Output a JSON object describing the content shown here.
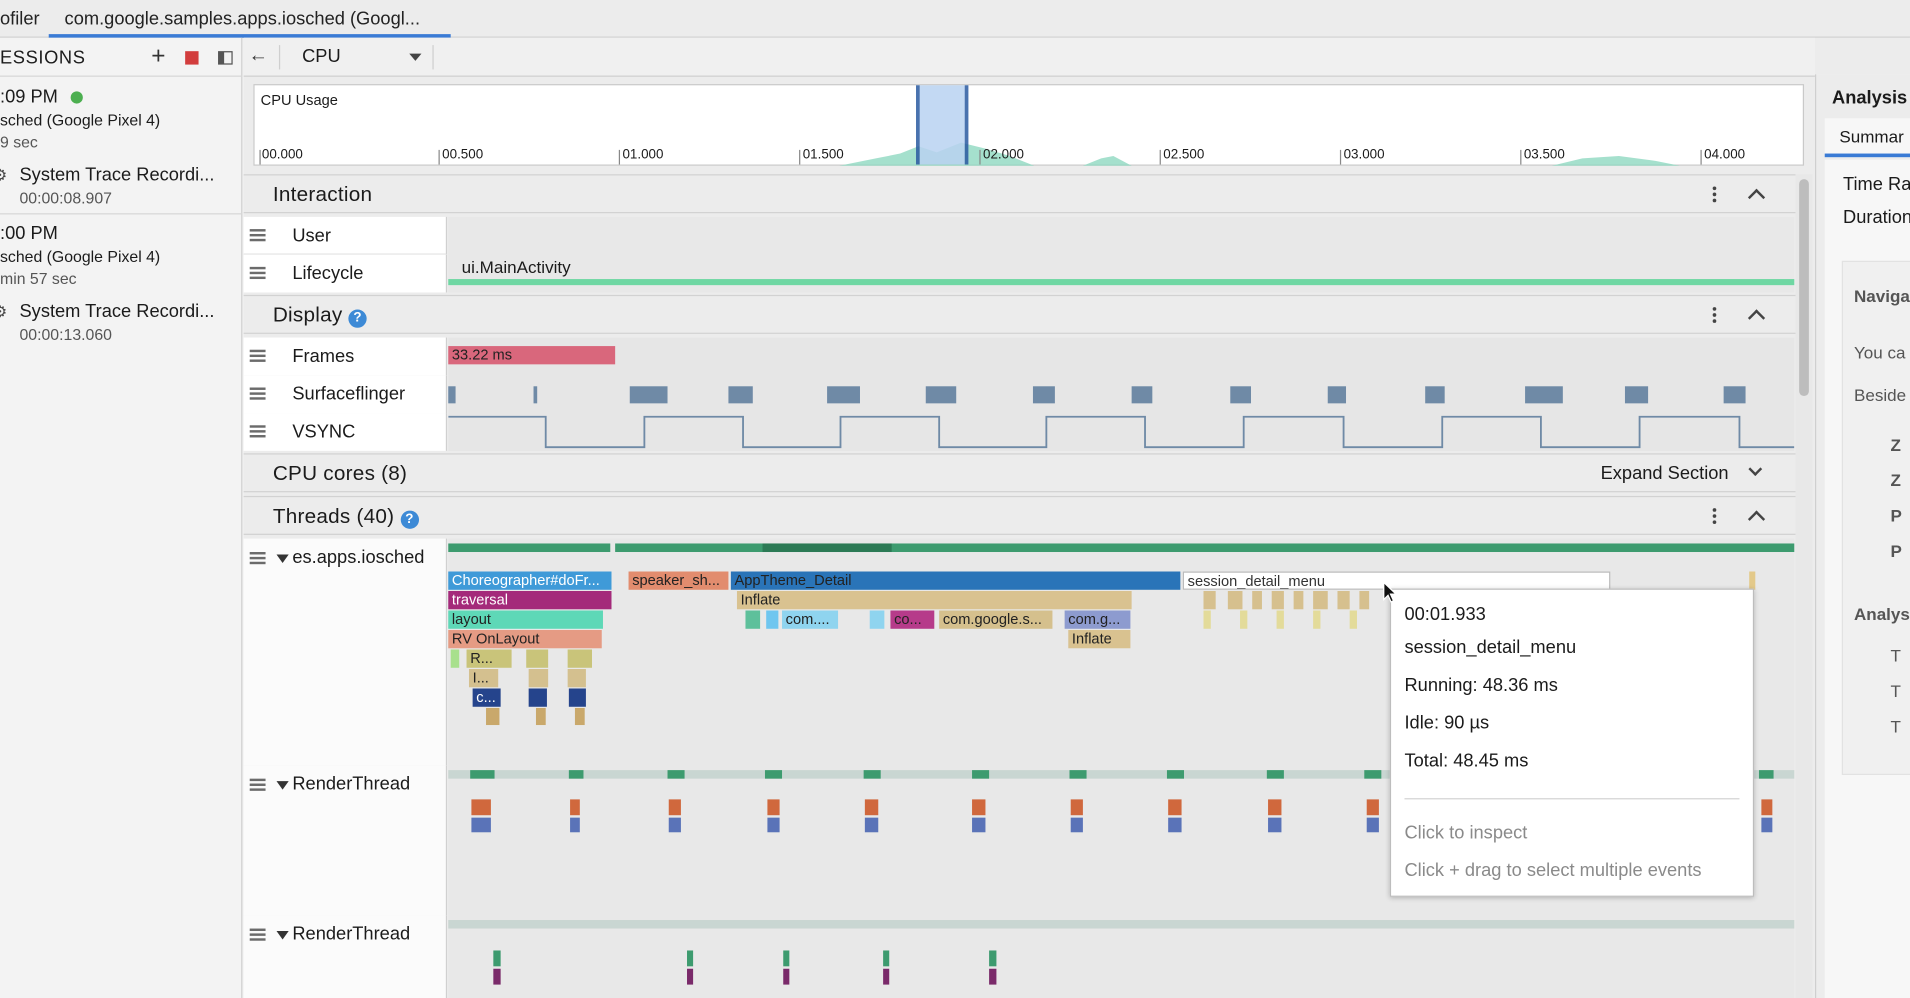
{
  "top_tabs": [
    "ofiler",
    "com.google.samples.apps.iosched (Googl..."
  ],
  "sidebar": {
    "title": "ESSIONS",
    "sessions": [
      {
        "time": ":09 PM",
        "device": "sched (Google Pixel 4)",
        "duration": "9 sec",
        "recording_title": "System Trace Recordi...",
        "recording_time": "00:00:08.907",
        "live": true
      },
      {
        "time": ":00 PM",
        "device": "sched (Google Pixel 4)",
        "duration": "min 57 sec",
        "recording_title": "System Trace Recordi...",
        "recording_time": "00:00:13.060",
        "live": false
      }
    ]
  },
  "toolbar": {
    "selected_profiler": "CPU"
  },
  "cpu_usage": {
    "label": "CPU Usage",
    "ticks": [
      "00.000",
      "00.500",
      "01.000",
      "01.500",
      "02.000",
      "02.500",
      "03.000",
      "03.500",
      "04.000"
    ]
  },
  "sections": {
    "interaction": {
      "title": "Interaction",
      "rows": [
        "User",
        "Lifecycle"
      ],
      "lifecycle_event": "ui.MainActivity"
    },
    "display": {
      "title": "Display",
      "rows": [
        "Frames",
        "Surfaceflinger",
        "VSYNC"
      ],
      "frame_event": "33.22 ms"
    },
    "cpu_cores": {
      "title": "CPU cores (8)",
      "action": "Expand Section"
    },
    "threads": {
      "title": "Threads (40)"
    }
  },
  "threads": [
    {
      "name": "es.apps.iosched",
      "events": [
        {
          "label": "Choreographer#doFr...",
          "color": "#3f9ad8"
        },
        {
          "label": "traversal",
          "color": "#a42a7a"
        },
        {
          "label": "layout",
          "color": "#5ed8b7"
        },
        {
          "label": "RV OnLayout",
          "color": "#e59b84"
        },
        {
          "label": "R...",
          "color": "#c9c47a"
        },
        {
          "label": "I...",
          "color": "#d4c08f"
        },
        {
          "label": "c...",
          "color": "#25448c"
        },
        {
          "label": "speaker_sh...",
          "color": "#e28c6e"
        },
        {
          "label": "AppTheme_Detail",
          "color": "#2a74b8"
        },
        {
          "label": "Inflate",
          "color": "#d9c290"
        },
        {
          "label": "com....",
          "color": "#8fd4ef"
        },
        {
          "label": "co...",
          "color": "#b63b8a"
        },
        {
          "label": "com.google.s...",
          "color": "#d5c08d"
        },
        {
          "label": "com.g...",
          "color": "#8d9bcf"
        },
        {
          "label": "Inflate",
          "color": "#d9c290"
        },
        {
          "label": "session_detail_menu",
          "color": "#ffffff"
        }
      ]
    },
    {
      "name": "RenderThread"
    },
    {
      "name": "RenderThread"
    }
  ],
  "tooltip": {
    "timestamp": "00:01.933",
    "name": "session_detail_menu",
    "running": "Running: 48.36 ms",
    "idle": "Idle: 90 µs",
    "total": "Total: 48.45 ms",
    "hint1": "Click to inspect",
    "hint2": "Click + drag to select multiple events"
  },
  "right_panel": {
    "title": "Analysis",
    "tab": "Summar",
    "fields": [
      "Time Ra",
      "Duration"
    ],
    "nav_title": "Naviga",
    "nav_lines": [
      "You ca",
      "Beside"
    ],
    "nav_keys": [
      "Z",
      "Z",
      "P",
      "P"
    ],
    "analysis_title": "Analys",
    "analysis_items": [
      "T",
      "T",
      "T"
    ]
  },
  "colors": {
    "accent": "#3a7bd5",
    "lifecycle": "#6fd7a3",
    "frames": "#d9677c",
    "surfaceflinger": "#6f8aa6",
    "thread_state": "#3d9b6f"
  }
}
